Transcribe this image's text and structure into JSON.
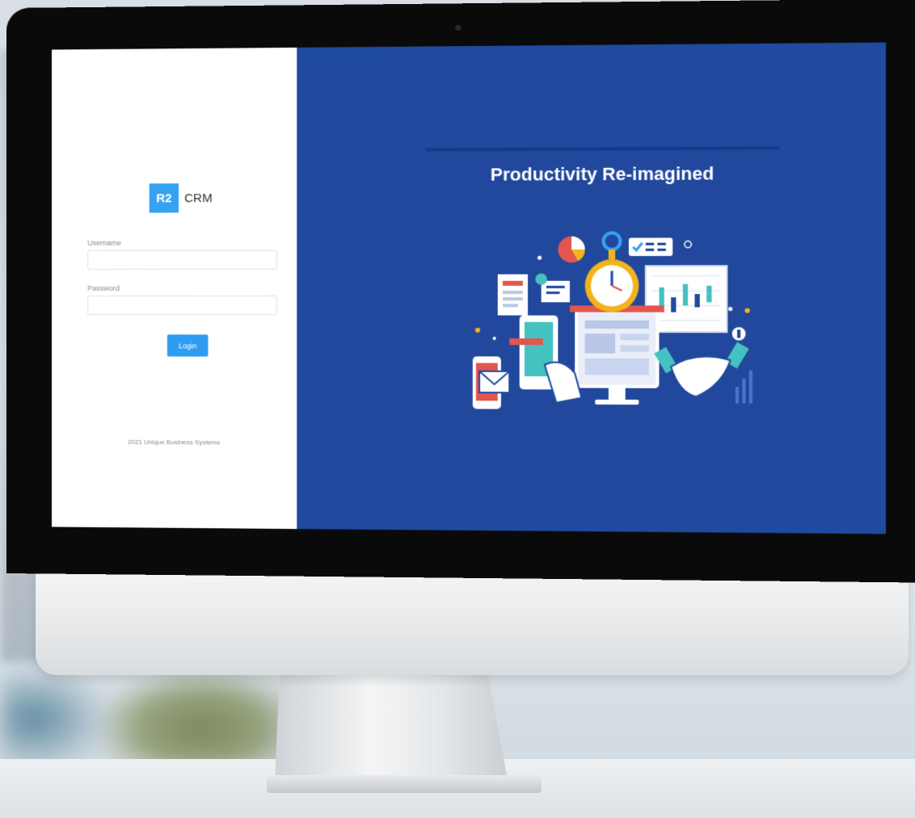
{
  "app": {
    "logo_badge": "R2",
    "logo_name": "CRM"
  },
  "login": {
    "username_label": "Username",
    "username_value": "",
    "password_label": "Password",
    "password_value": "",
    "login_button": "Login",
    "footer": "2021 Unique Business Systems"
  },
  "hero": {
    "title": "Productivity Re-imagined"
  },
  "colors": {
    "brand_blue": "#35a2f2",
    "hero_background": "#1f4aa0",
    "accent_yellow": "#f2b31c"
  }
}
